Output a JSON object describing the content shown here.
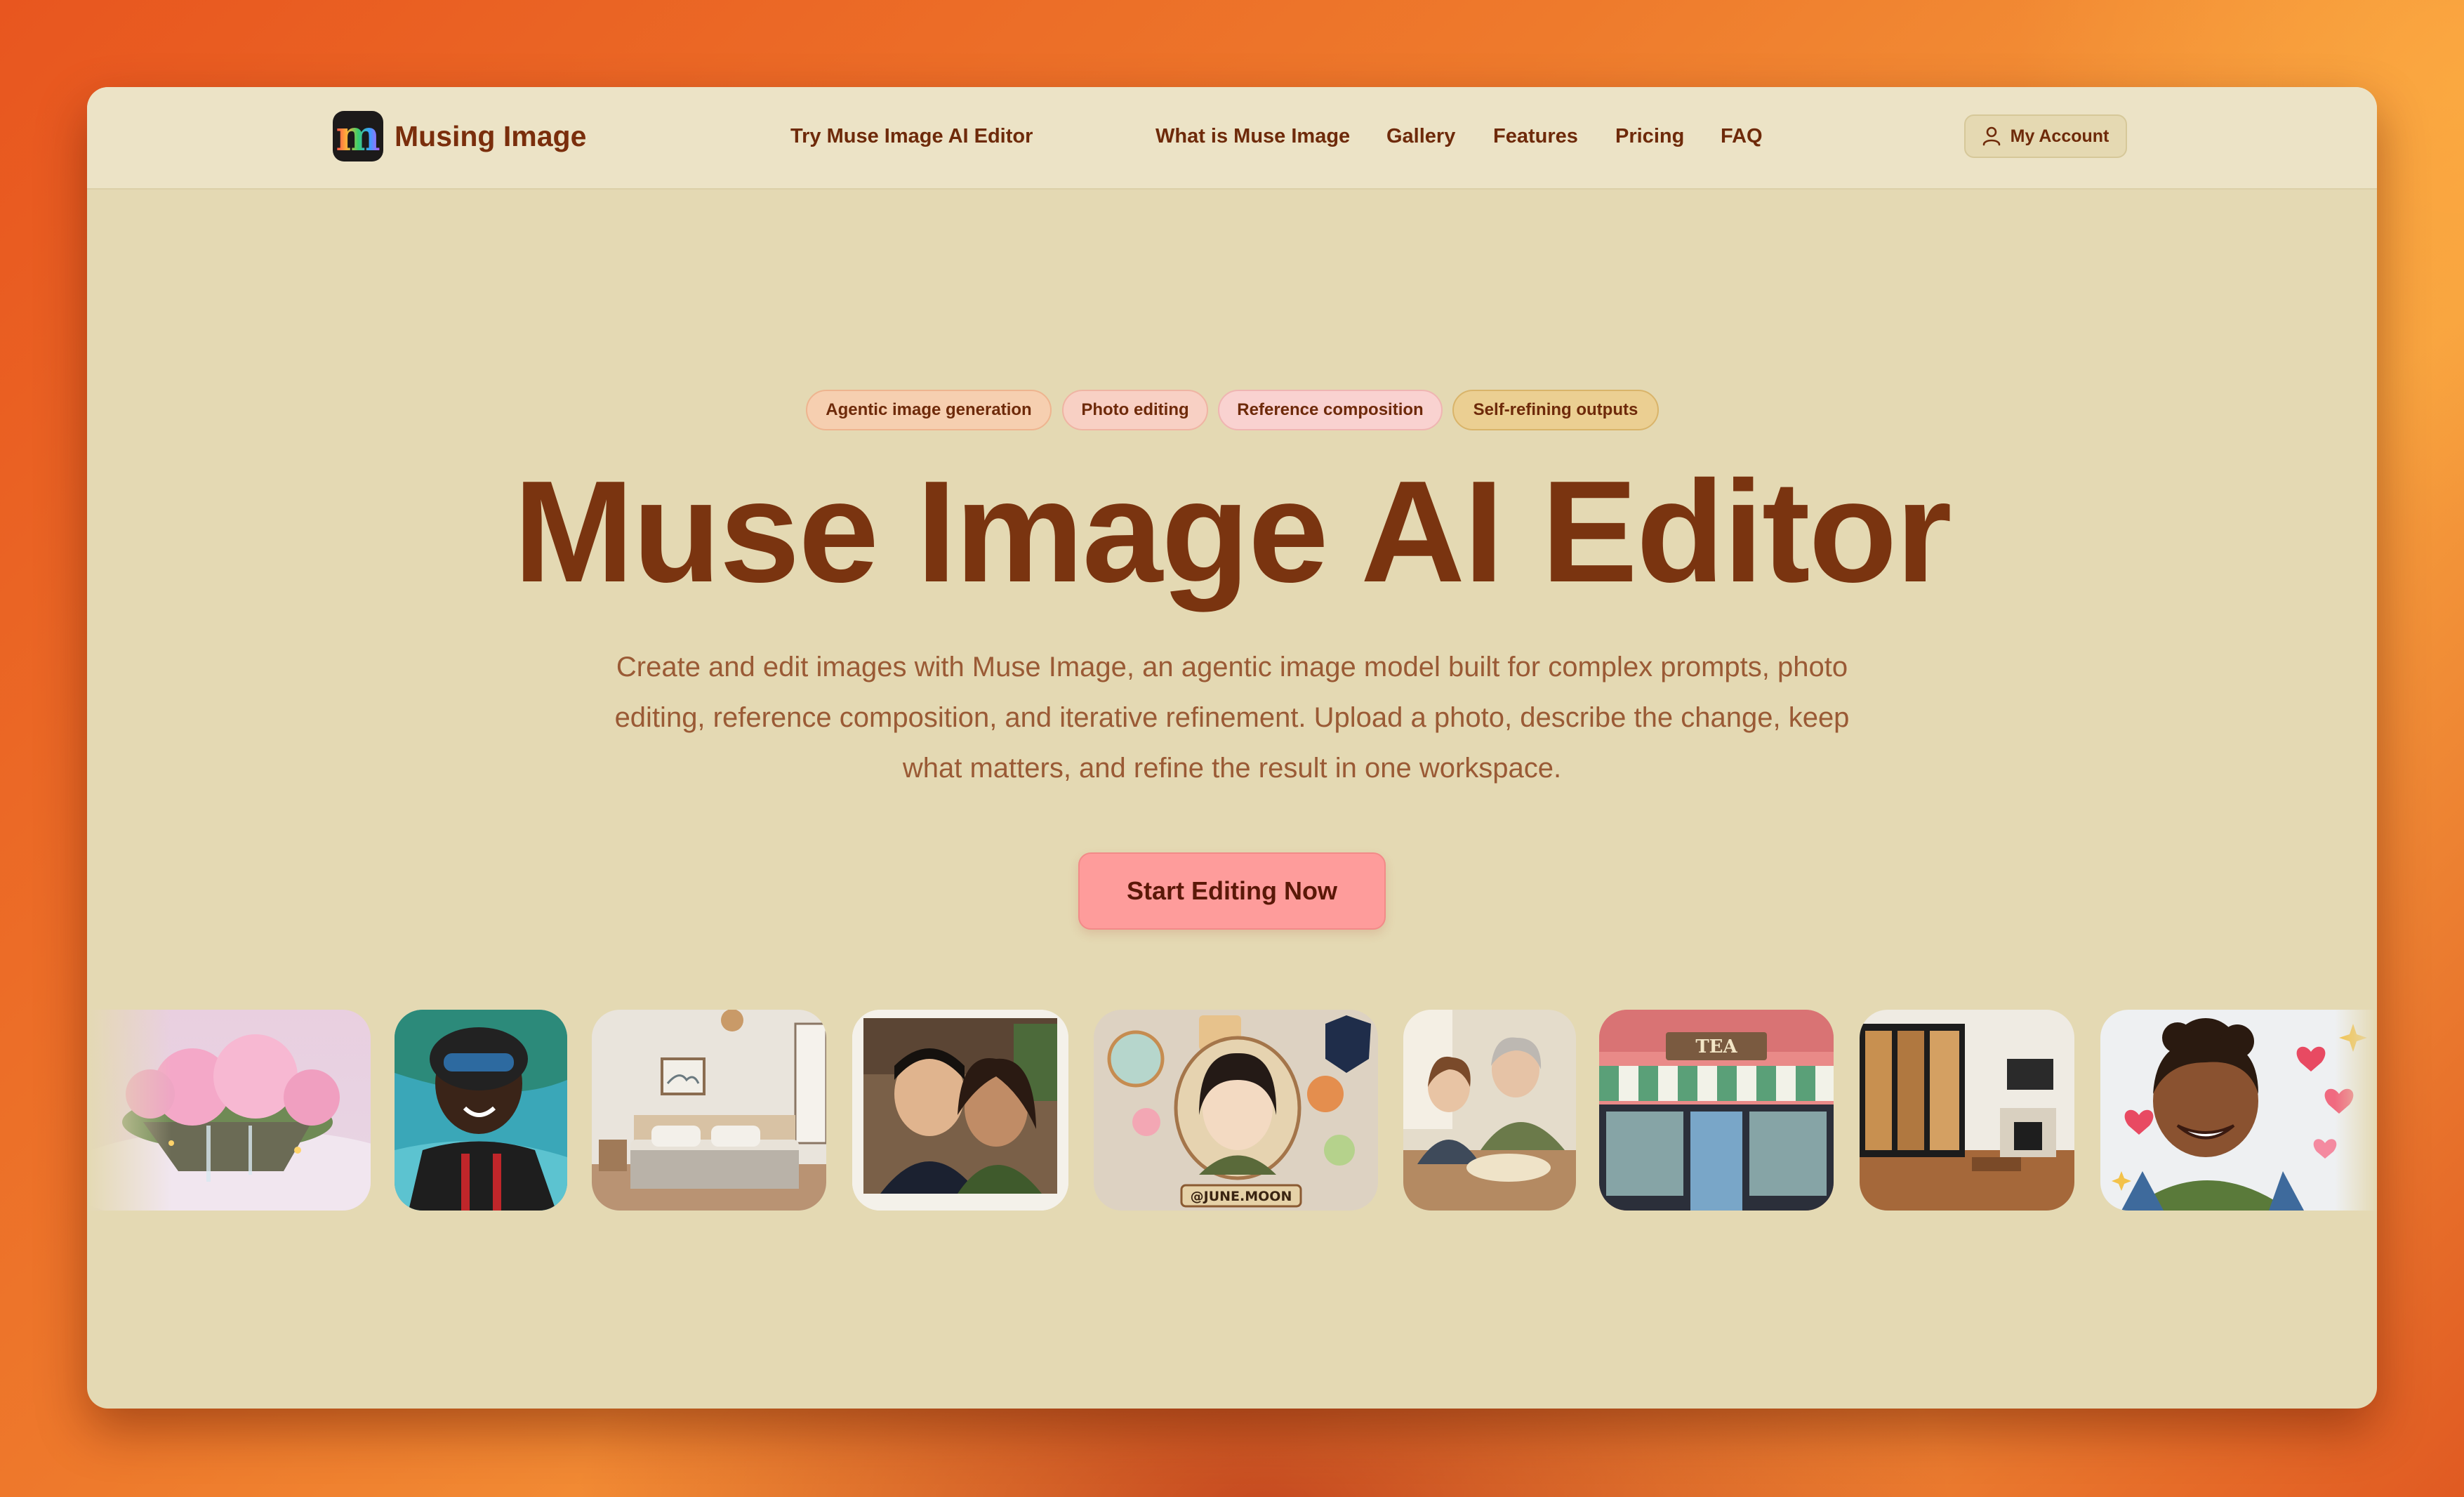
{
  "brand": {
    "name": "Musing Image",
    "logo_icon": "m-logo-icon"
  },
  "nav": {
    "items": [
      {
        "label": "Try Muse Image AI Editor"
      },
      {
        "label": "What is Muse Image"
      },
      {
        "label": "Gallery"
      },
      {
        "label": "Features"
      },
      {
        "label": "Pricing"
      },
      {
        "label": "FAQ"
      }
    ],
    "account_label": "My Account",
    "account_icon": "user-icon"
  },
  "hero": {
    "tags": [
      "Agentic image generation",
      "Photo editing",
      "Reference composition",
      "Self-refining outputs"
    ],
    "title": "Muse Image AI Editor",
    "description": "Create and edit images with Muse Image, an agentic image model built for complex prompts, photo editing, reference composition, and iterative refinement. Upload a photo, describe the change, keep what matters, and refine the result in one workspace.",
    "cta_label": "Start Editing Now"
  },
  "gallery": {
    "badge_handle": "@JUNE.MOON",
    "storefront_sign": "TEA"
  },
  "colors": {
    "page_bg": "#e4d9b3",
    "topbar_bg": "#ece3c6",
    "title": "#7a3410",
    "cta": "#fe9c9b"
  }
}
